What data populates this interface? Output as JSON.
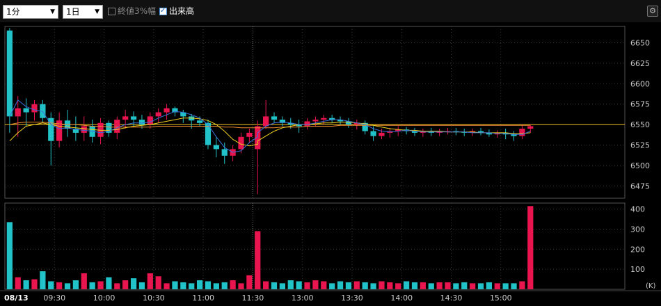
{
  "toolbar": {
    "interval": "1分",
    "period": "1日",
    "close3pct_label": "終値3%幅",
    "close3pct_checked": false,
    "volume_label": "出来高",
    "volume_checked": true,
    "settings_icon": "gear-icon"
  },
  "chart_data": [
    {
      "type": "candlestick",
      "date_label": "08/13",
      "x_ticks": [
        "09:30",
        "10:00",
        "10:30",
        "11:00",
        "11:30",
        "13:00",
        "13:30",
        "14:00",
        "14:30",
        "15:00"
      ],
      "y_ticks": [
        6475,
        6500,
        6525,
        6550,
        6575,
        6600,
        6625,
        6650
      ],
      "ylim": [
        6460,
        6670
      ],
      "x": [
        "09:00",
        "09:05",
        "09:10",
        "09:15",
        "09:20",
        "09:25",
        "09:30",
        "09:35",
        "09:40",
        "09:45",
        "09:50",
        "09:55",
        "10:00",
        "10:05",
        "10:10",
        "10:15",
        "10:20",
        "10:25",
        "10:30",
        "10:35",
        "10:40",
        "10:45",
        "10:50",
        "10:55",
        "11:00",
        "11:05",
        "11:10",
        "11:15",
        "11:20",
        "11:25",
        "11:30",
        "12:30",
        "12:35",
        "12:40",
        "12:45",
        "12:50",
        "12:55",
        "13:00",
        "13:05",
        "13:10",
        "13:15",
        "13:20",
        "13:25",
        "13:30",
        "13:35",
        "13:40",
        "13:45",
        "13:50",
        "13:55",
        "14:00",
        "14:05",
        "14:10",
        "14:15",
        "14:20",
        "14:25",
        "14:30",
        "14:35",
        "14:40",
        "14:45",
        "14:50",
        "14:55",
        "15:00",
        "15:05",
        "15:10",
        "15:15"
      ],
      "ohlc": [
        [
          6665,
          6668,
          6540,
          6560
        ],
        [
          6560,
          6585,
          6535,
          6570
        ],
        [
          6570,
          6582,
          6548,
          6565
        ],
        [
          6565,
          6580,
          6555,
          6575
        ],
        [
          6575,
          6580,
          6552,
          6558
        ],
        [
          6558,
          6565,
          6500,
          6530
        ],
        [
          6530,
          6565,
          6522,
          6555
        ],
        [
          6555,
          6568,
          6535,
          6545
        ],
        [
          6545,
          6560,
          6530,
          6540
        ],
        [
          6540,
          6560,
          6530,
          6548
        ],
        [
          6548,
          6556,
          6528,
          6535
        ],
        [
          6535,
          6558,
          6526,
          6552
        ],
        [
          6552,
          6555,
          6535,
          6540
        ],
        [
          6540,
          6560,
          6532,
          6556
        ],
        [
          6556,
          6568,
          6545,
          6560
        ],
        [
          6560,
          6566,
          6548,
          6556
        ],
        [
          6556,
          6562,
          6545,
          6550
        ],
        [
          6550,
          6565,
          6545,
          6560
        ],
        [
          6560,
          6570,
          6552,
          6565
        ],
        [
          6565,
          6575,
          6556,
          6570
        ],
        [
          6570,
          6572,
          6560,
          6565
        ],
        [
          6565,
          6568,
          6552,
          6560
        ],
        [
          6560,
          6563,
          6545,
          6555
        ],
        [
          6555,
          6560,
          6548,
          6552
        ],
        [
          6552,
          6556,
          6520,
          6525
        ],
        [
          6525,
          6535,
          6510,
          6520
        ],
        [
          6520,
          6528,
          6502,
          6512
        ],
        [
          6512,
          6525,
          6505,
          6520
        ],
        [
          6520,
          6540,
          6515,
          6535
        ],
        [
          6535,
          6545,
          6528,
          6540
        ],
        [
          6520,
          6535,
          6465,
          6525
        ],
        [
          6525,
          6555,
          6520,
          6548
        ],
        [
          6548,
          6580,
          6545,
          6560
        ],
        [
          6560,
          6565,
          6552,
          6556
        ],
        [
          6556,
          6560,
          6548,
          6552
        ],
        [
          6552,
          6558,
          6545,
          6550
        ],
        [
          6550,
          6556,
          6540,
          6548
        ],
        [
          6548,
          6558,
          6544,
          6554
        ],
        [
          6554,
          6560,
          6548,
          6556
        ],
        [
          6556,
          6562,
          6550,
          6558
        ],
        [
          6558,
          6562,
          6552,
          6556
        ],
        [
          6556,
          6560,
          6550,
          6554
        ],
        [
          6554,
          6558,
          6546,
          6550
        ],
        [
          6550,
          6556,
          6544,
          6552
        ],
        [
          6552,
          6555,
          6538,
          6542
        ],
        [
          6542,
          6548,
          6530,
          6536
        ],
        [
          6536,
          6545,
          6532,
          6540
        ],
        [
          6540,
          6546,
          6534,
          6542
        ],
        [
          6542,
          6548,
          6536,
          6544
        ],
        [
          6544,
          6547,
          6538,
          6542
        ],
        [
          6542,
          6546,
          6536,
          6540
        ],
        [
          6540,
          6545,
          6535,
          6542
        ],
        [
          6542,
          6546,
          6536,
          6540
        ],
        [
          6540,
          6545,
          6536,
          6542
        ],
        [
          6542,
          6546,
          6538,
          6542
        ],
        [
          6542,
          6546,
          6537,
          6541
        ],
        [
          6541,
          6545,
          6536,
          6540
        ],
        [
          6540,
          6545,
          6536,
          6542
        ],
        [
          6542,
          6546,
          6537,
          6540
        ],
        [
          6540,
          6544,
          6535,
          6538
        ],
        [
          6538,
          6543,
          6534,
          6540
        ],
        [
          6540,
          6545,
          6532,
          6538
        ],
        [
          6538,
          6542,
          6530,
          6536
        ],
        [
          6536,
          6550,
          6532,
          6545
        ],
        [
          6545,
          6550,
          6540,
          6548
        ]
      ],
      "ma_short": [
        6560,
        6580,
        6572,
        6568,
        6566,
        6550,
        6545,
        6546,
        6544,
        6543,
        6542,
        6540,
        6542,
        6546,
        6550,
        6552,
        6552,
        6553,
        6558,
        6562,
        6566,
        6565,
        6562,
        6558,
        6550,
        6535,
        6522,
        6516,
        6518,
        6528,
        6535,
        6540,
        6548,
        6552,
        6553,
        6552,
        6550,
        6550,
        6552,
        6554,
        6556,
        6556,
        6554,
        6552,
        6550,
        6545,
        6542,
        6541,
        6542,
        6543,
        6542,
        6541,
        6541,
        6541,
        6541,
        6541,
        6541,
        6540,
        6540,
        6540,
        6539,
        6539,
        6538,
        6538,
        6542
      ],
      "ma_mid": [
        6530,
        6540,
        6548,
        6550,
        6552,
        6550,
        6548,
        6547,
        6546,
        6545,
        6544,
        6543,
        6543,
        6544,
        6546,
        6548,
        6549,
        6550,
        6552,
        6554,
        6556,
        6558,
        6558,
        6557,
        6555,
        6550,
        6542,
        6532,
        6526,
        6524,
        6526,
        6530,
        6536,
        6542,
        6546,
        6548,
        6550,
        6550,
        6551,
        6552,
        6552,
        6553,
        6553,
        6552,
        6551,
        6549,
        6547,
        6545,
        6544,
        6543,
        6543,
        6542,
        6542,
        6542,
        6541,
        6541,
        6541,
        6541,
        6540,
        6540,
        6540,
        6540,
        6539,
        6539,
        6540
      ],
      "ma_long": [
        6550,
        6552,
        6553,
        6553,
        6553,
        6552,
        6551,
        6550,
        6550,
        6549,
        6548,
        6548,
        6547,
        6547,
        6547,
        6547,
        6547,
        6547,
        6548,
        6548,
        6548,
        6548,
        6548,
        6548,
        6548,
        6548,
        6547,
        6547,
        6546,
        6546,
        6546,
        6546,
        6546,
        6546,
        6547,
        6547,
        6547,
        6548,
        6548,
        6548,
        6548,
        6549,
        6549,
        6549,
        6549,
        6549,
        6549,
        6549,
        6549,
        6549,
        6549,
        6549,
        6549,
        6549,
        6549,
        6549,
        6549,
        6549,
        6549,
        6549,
        6549,
        6549,
        6549,
        6549,
        6549
      ],
      "ref_line": 6550,
      "colors": {
        "up": "#e8154f",
        "down": "#22c3c8",
        "ma_short": "#3a6fd8",
        "ma_mid": "#f0d020",
        "ma_long": "#f08a30",
        "ref": "#f0c020"
      }
    },
    {
      "type": "bar",
      "unit": "(K)",
      "y_ticks": [
        100,
        200,
        300,
        400
      ],
      "ylim": [
        0,
        430
      ],
      "values": [
        335,
        60,
        45,
        50,
        90,
        40,
        35,
        30,
        45,
        80,
        35,
        40,
        60,
        30,
        45,
        55,
        35,
        80,
        65,
        30,
        40,
        35,
        30,
        45,
        40,
        30,
        35,
        45,
        30,
        70,
        290,
        50,
        40,
        35,
        30,
        45,
        40,
        35,
        45,
        40,
        30,
        40,
        35,
        40,
        35,
        30,
        40,
        35,
        30,
        40,
        35,
        35,
        30,
        35,
        35,
        30,
        35,
        30,
        30,
        35,
        30,
        30,
        30,
        40,
        415
      ],
      "colors": {
        "up": "#e8154f",
        "down": "#22c3c8"
      }
    }
  ]
}
